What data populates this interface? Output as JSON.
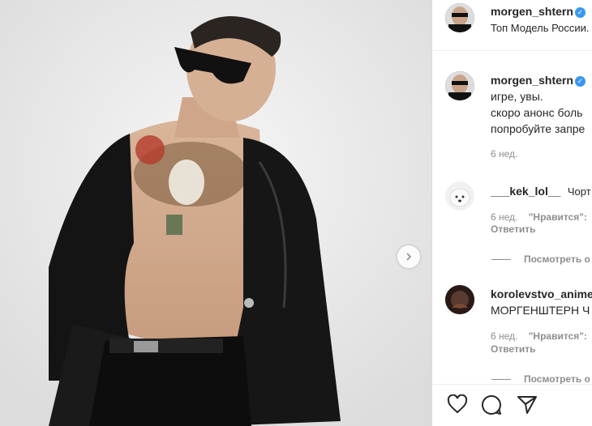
{
  "post": {
    "author": "morgen_shtern",
    "location": "Топ Модель России.",
    "caption_lines": [
      "игре, увы.",
      "скоро анонс боль",
      "попробуйте запре"
    ],
    "time": "6 нед."
  },
  "comments": [
    {
      "user": "___kek_lol__",
      "text": "Чорт",
      "time": "6 нед.",
      "likes_label": "\"Нравится\":",
      "reply_label": "Ответить",
      "view_replies": "Посмотреть о"
    },
    {
      "user": "korolevstvo_anime",
      "text": "МОРГЕНШТЕРН Ч",
      "time": "6 нед.",
      "likes_label": "\"Нравится\":",
      "reply_label": "Ответить",
      "view_replies": "Посмотреть о"
    }
  ],
  "icons": {
    "verified": "verified-badge-icon",
    "next": "chevron-right-icon",
    "like": "heart-icon",
    "comment": "comment-bubble-icon",
    "share": "paper-plane-icon"
  },
  "colors": {
    "verified": "#3897f0",
    "text": "#262626",
    "muted": "#8e8e8e"
  }
}
